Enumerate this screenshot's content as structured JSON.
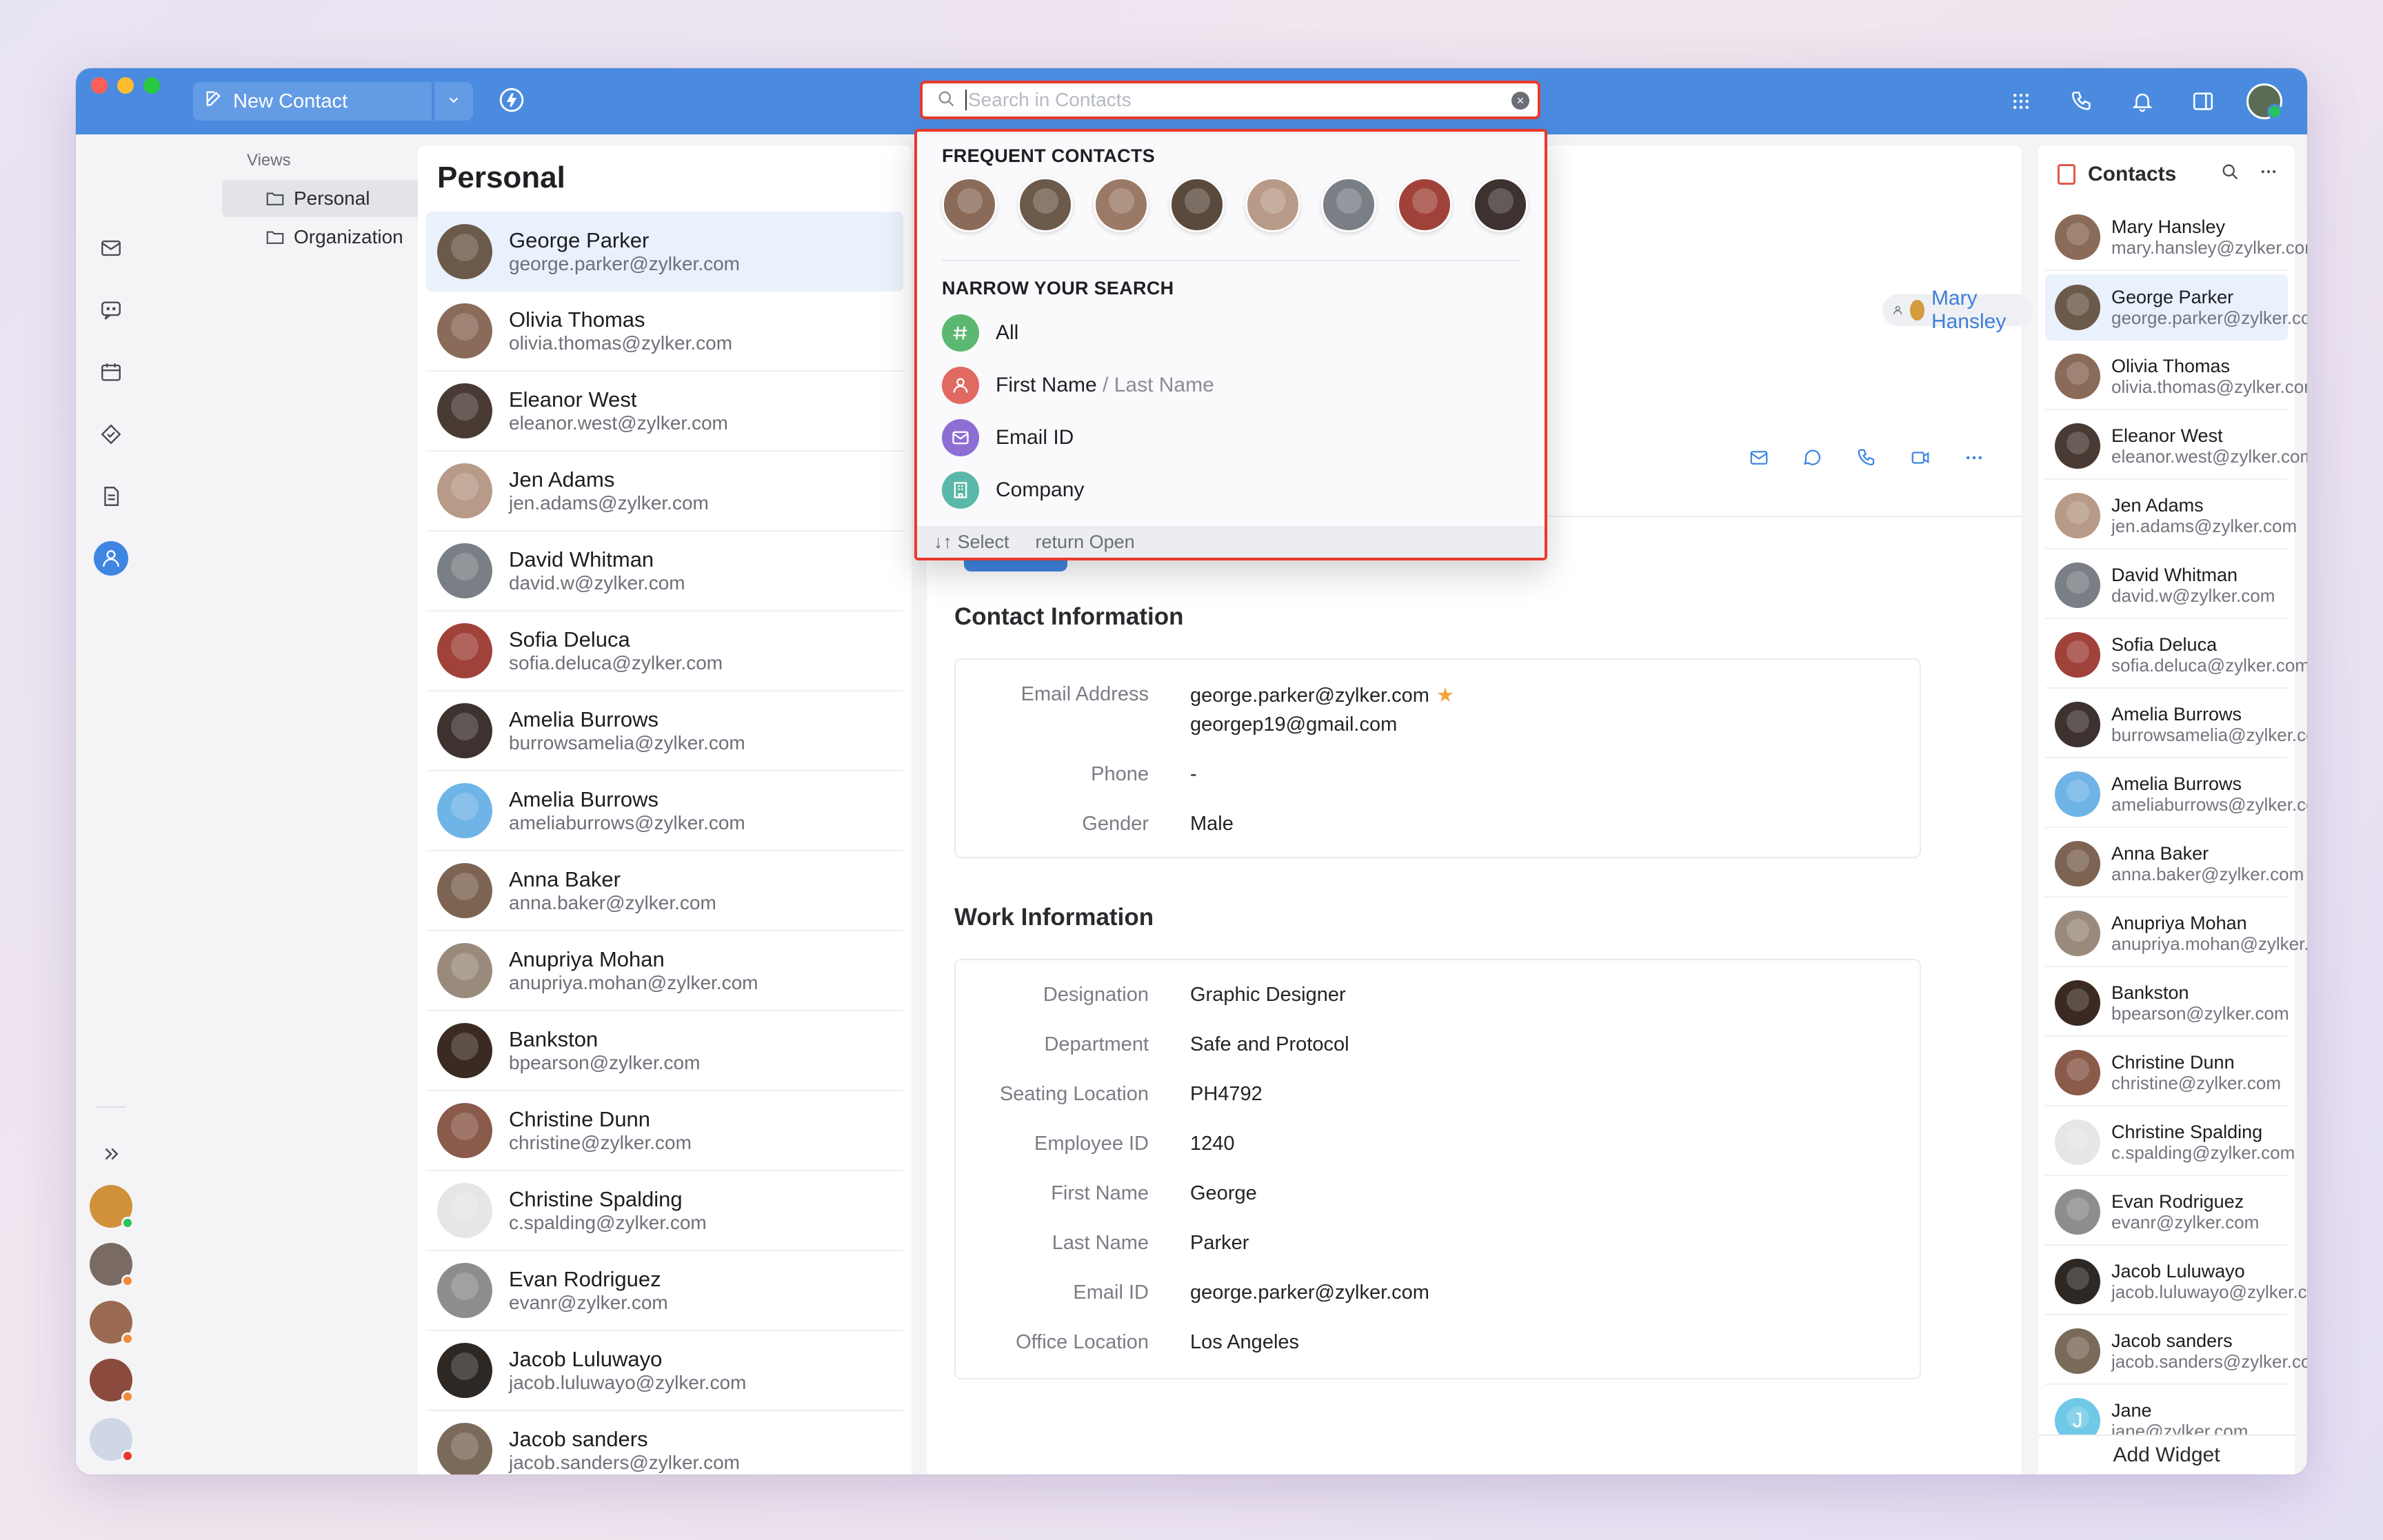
{
  "toolbar": {
    "new_contact_label": "New Contact",
    "search_placeholder": "Search in Contacts"
  },
  "views": {
    "heading": "Views",
    "items": [
      {
        "label": "Personal",
        "selected": true
      },
      {
        "label": "Organization",
        "selected": false
      }
    ]
  },
  "list": {
    "title": "Personal",
    "contacts": [
      {
        "name": "George Parker",
        "email": "george.parker@zylker.com",
        "color": "#6b5a4a"
      },
      {
        "name": "Olivia Thomas",
        "email": "olivia.thomas@zylker.com",
        "color": "#8a6a58"
      },
      {
        "name": "Eleanor West",
        "email": "eleanor.west@zylker.com",
        "color": "#4a3a34"
      },
      {
        "name": "Jen Adams",
        "email": "jen.adams@zylker.com",
        "color": "#b89a88"
      },
      {
        "name": "David Whitman",
        "email": "david.w@zylker.com",
        "color": "#7a7f86"
      },
      {
        "name": "Sofia Deluca",
        "email": "sofia.deluca@zylker.com",
        "color": "#a0423a"
      },
      {
        "name": "Amelia Burrows",
        "email": "burrowsamelia@zylker.com",
        "color": "#3d3230"
      },
      {
        "name": "Amelia Burrows",
        "email": "ameliaburrows@zylker.com",
        "color": "#6fb4e6"
      },
      {
        "name": "Anna Baker",
        "email": "anna.baker@zylker.com",
        "color": "#7d6452"
      },
      {
        "name": "Anupriya Mohan",
        "email": "anupriya.mohan@zylker.com",
        "color": "#9a8a7c"
      },
      {
        "name": "Bankston",
        "email": "bpearson@zylker.com",
        "color": "#3a2a22"
      },
      {
        "name": "Christine Dunn",
        "email": "christine@zylker.com",
        "color": "#8a5a4a"
      },
      {
        "name": "Christine Spalding",
        "email": "c.spalding@zylker.com",
        "color": "#e8e6e4"
      },
      {
        "name": "Evan Rodriguez",
        "email": "evanr@zylker.com",
        "color": "#8d8d8d"
      },
      {
        "name": "Jacob Luluwayo",
        "email": "jacob.luluwayo@zylker.com",
        "color": "#2e2824"
      },
      {
        "name": "Jacob sanders",
        "email": "jacob.sanders@zylker.com",
        "color": "#7a6a5a"
      }
    ]
  },
  "detail": {
    "owner_label": "Mary Hansley",
    "contact_section_title": "Contact Information",
    "contact_fields": [
      {
        "label": "Email Address",
        "value": "george.parker@zylker.com",
        "value2": "georgep19@gmail.com"
      },
      {
        "label": "Phone",
        "value": "-"
      },
      {
        "label": "Gender",
        "value": "Male"
      }
    ],
    "work_section_title": "Work Information",
    "work_fields": [
      {
        "label": "Designation",
        "value": "Graphic Designer"
      },
      {
        "label": "Department",
        "value": "Safe and Protocol"
      },
      {
        "label": "Seating Location",
        "value": "PH4792"
      },
      {
        "label": "Employee ID",
        "value": "1240"
      },
      {
        "label": "First Name",
        "value": "George"
      },
      {
        "label": "Last Name",
        "value": "Parker"
      },
      {
        "label": "Email ID",
        "value": "george.parker@zylker.com"
      },
      {
        "label": "Office Location",
        "value": "Los Angeles"
      }
    ]
  },
  "widget": {
    "title": "Contacts",
    "footer": "Add Widget",
    "contacts": [
      {
        "name": "Mary Hansley",
        "email": "mary.hansley@zylker.com",
        "color": "#8a6a58"
      },
      {
        "name": "George Parker",
        "email": "george.parker@zylker.com",
        "color": "#6b5a4a"
      },
      {
        "name": "Olivia Thomas",
        "email": "olivia.thomas@zylker.com",
        "color": "#8a6a58"
      },
      {
        "name": "Eleanor West",
        "email": "eleanor.west@zylker.com",
        "color": "#4a3a34"
      },
      {
        "name": "Jen Adams",
        "email": "jen.adams@zylker.com",
        "color": "#b89a88"
      },
      {
        "name": "David Whitman",
        "email": "david.w@zylker.com",
        "color": "#7a7f86"
      },
      {
        "name": "Sofia Deluca",
        "email": "sofia.deluca@zylker.com",
        "color": "#a0423a"
      },
      {
        "name": "Amelia Burrows",
        "email": "burrowsamelia@zylker.com",
        "color": "#3d3230"
      },
      {
        "name": "Amelia Burrows",
        "email": "ameliaburrows@zylker.com",
        "color": "#6fb4e6"
      },
      {
        "name": "Anna Baker",
        "email": "anna.baker@zylker.com",
        "color": "#7d6452"
      },
      {
        "name": "Anupriya Mohan",
        "email": "anupriya.mohan@zylker.com",
        "color": "#9a8a7c"
      },
      {
        "name": "Bankston",
        "email": "bpearson@zylker.com",
        "color": "#3a2a22"
      },
      {
        "name": "Christine Dunn",
        "email": "christine@zylker.com",
        "color": "#8a5a4a"
      },
      {
        "name": "Christine Spalding",
        "email": "c.spalding@zylker.com",
        "color": "#e8e6e4"
      },
      {
        "name": "Evan Rodriguez",
        "email": "evanr@zylker.com",
        "color": "#8d8d8d"
      },
      {
        "name": "Jacob Luluwayo",
        "email": "jacob.luluwayo@zylker.com",
        "color": "#2e2824"
      },
      {
        "name": "Jacob sanders",
        "email": "jacob.sanders@zylker.com",
        "color": "#7a6a5a"
      },
      {
        "name": "Jane",
        "email": "jane@zylker.com",
        "color": "#6fc8e6",
        "initial": "J"
      }
    ]
  },
  "dropdown": {
    "frequent_heading": "FREQUENT CONTACTS",
    "frequent_colors": [
      "#8a6a58",
      "#6b5a4a",
      "#9a7a66",
      "#5a4a3e",
      "#b89a88",
      "#7a7f86",
      "#a0423a",
      "#3d3230"
    ],
    "narrow_heading": "NARROW YOUR SEARCH",
    "options": [
      {
        "label": "All",
        "suffix": "",
        "color": "#5cb870",
        "icon": "hash-icon"
      },
      {
        "label": "First Name",
        "suffix": "/ Last Name",
        "color": "#e06a62",
        "icon": "person-icon"
      },
      {
        "label": "Email ID",
        "suffix": "",
        "color": "#8d6fd4",
        "icon": "mail-icon"
      },
      {
        "label": "Company",
        "suffix": "",
        "color": "#5ab8a8",
        "icon": "building-icon"
      }
    ],
    "footer_select": "↓↑ Select",
    "footer_open": "return Open"
  }
}
